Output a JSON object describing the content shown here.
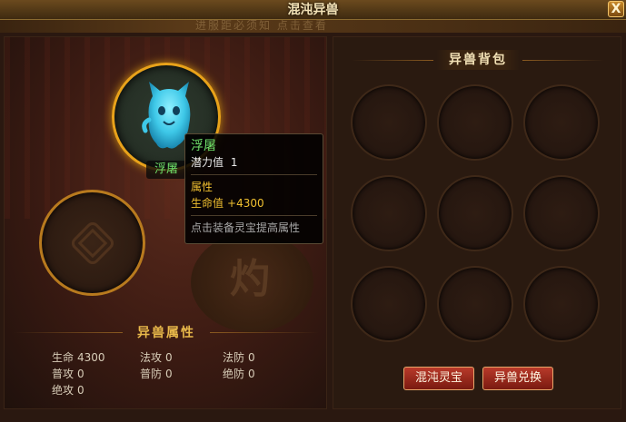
{
  "window": {
    "title": "混沌异兽",
    "close_label": "X",
    "banner_text": "进服距必须知 点击查看"
  },
  "pet": {
    "name": "浮屠"
  },
  "tooltip": {
    "name": "浮屠",
    "potential_label": "潜力值",
    "potential_value": "1",
    "attr_header": "属性",
    "hp_label": "生命值",
    "hp_value": "+4300",
    "hint": "点击装备灵宝提高属性"
  },
  "attributes": {
    "title": "异兽属性",
    "stats": [
      {
        "label": "生命",
        "value": "4300"
      },
      {
        "label": "法攻",
        "value": "0"
      },
      {
        "label": "法防",
        "value": "0"
      },
      {
        "label": "普攻",
        "value": "0"
      },
      {
        "label": "普防",
        "value": "0"
      },
      {
        "label": "绝防",
        "value": "0"
      },
      {
        "label": "绝攻",
        "value": "0"
      }
    ]
  },
  "bag": {
    "title": "异兽背包",
    "slot_count": 9,
    "buttons": {
      "chaos_treasure": "混沌灵宝",
      "exchange": "异兽兑换"
    }
  },
  "colors": {
    "accent_gold": "#e8a21a",
    "pet_name_green": "#6fe06a",
    "tooltip_yellow": "#f0c030",
    "button_red": "#b83a2a"
  },
  "icons": {
    "pet": "blue-ghost-icon",
    "slot_pattern": "endless-knot-icon"
  }
}
